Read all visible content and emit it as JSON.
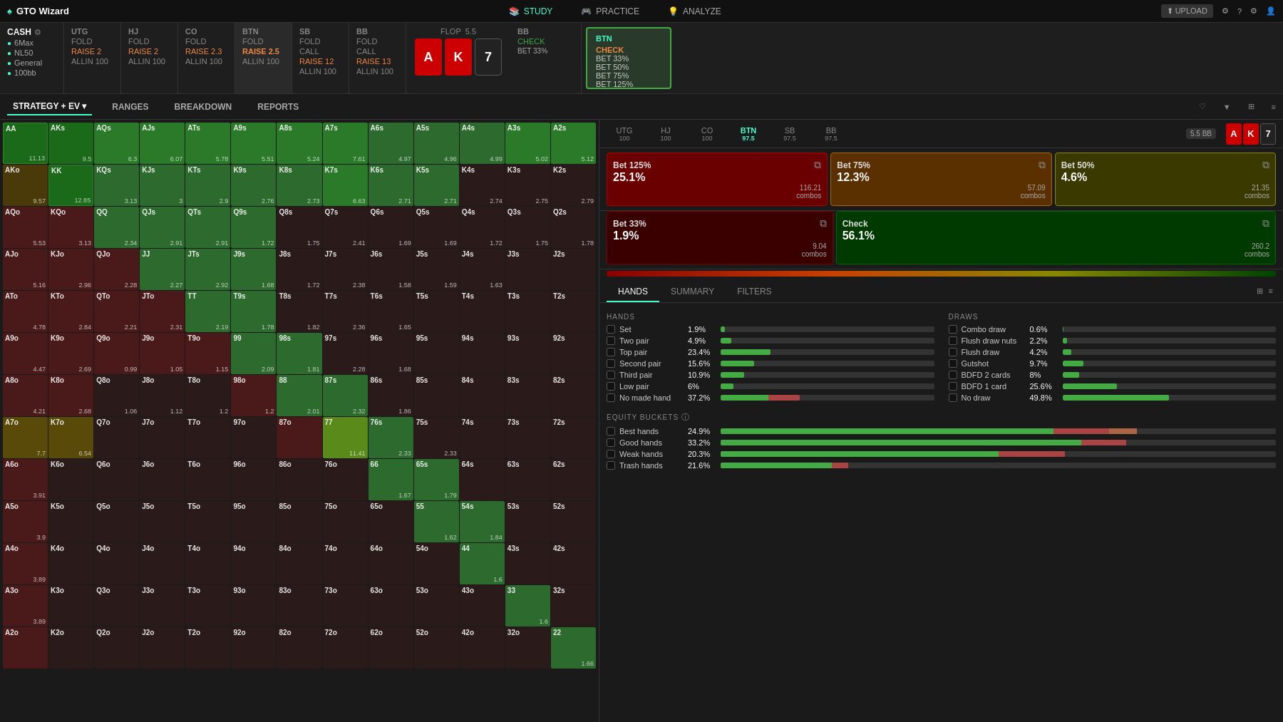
{
  "brand": {
    "name": "GTO Wizard",
    "icon": "♠"
  },
  "nav": {
    "items": [
      {
        "label": "STUDY",
        "icon": "📚",
        "active": true
      },
      {
        "label": "PRACTICE",
        "icon": "🎮",
        "active": false
      },
      {
        "label": "ANALYZE",
        "icon": "💡",
        "active": false
      }
    ],
    "right": [
      "upload_icon",
      "settings1",
      "settings2",
      "settings3",
      "avatar"
    ]
  },
  "positions": [
    {
      "label": "CASH",
      "sublabel": "",
      "actions": [
        "6Max",
        "NL50",
        "General",
        "100bb"
      ],
      "is_cash": true
    },
    {
      "label": "UTG",
      "sublabel": "",
      "actions": [
        "FOLD",
        "RAISE 2",
        "ALLIN 100"
      ]
    },
    {
      "label": "HJ",
      "sublabel": "",
      "actions": [
        "FOLD",
        "RAISE 2",
        "ALLIN 100"
      ]
    },
    {
      "label": "CO",
      "sublabel": "",
      "actions": [
        "FOLD",
        "RAISE 2.3",
        "ALLIN 100"
      ]
    },
    {
      "label": "BTN",
      "sublabel": "",
      "actions": [
        "FOLD",
        "RAISE 2.5",
        "ALLIN 100"
      ],
      "active": true
    },
    {
      "label": "SB",
      "sublabel": "",
      "actions": [
        "FOLD",
        "CALL",
        "RAISE 12",
        "ALLIN 100"
      ]
    },
    {
      "label": "BB",
      "sublabel": "",
      "actions": [
        "FOLD",
        "CALL",
        "RAISE 13",
        "ALLIN 100"
      ]
    }
  ],
  "flop": {
    "label": "FLOP",
    "value": "5.5",
    "cards": [
      "A",
      "K",
      "7"
    ]
  },
  "bb_action": {
    "label": "BB",
    "action": "CHECK",
    "details": "BET 33%"
  },
  "btn_actions": {
    "label": "BTN",
    "actions": [
      "CHECK",
      "BET 33%",
      "BET 50%",
      "BET 75%",
      "BET 125%"
    ]
  },
  "toolbar": {
    "items": [
      "STRATEGY + EV",
      "RANGES",
      "BREAKDOWN",
      "REPORTS"
    ]
  },
  "matrix": {
    "rows": [
      [
        "AA",
        "AKs",
        "AQs",
        "AJs",
        "ATs",
        "A9s",
        "A8s",
        "A7s",
        "A6s",
        "A5s",
        "A4s",
        "A3s",
        "A2s"
      ],
      [
        "AKo",
        "KK",
        "KQs",
        "KJs",
        "KTs",
        "K9s",
        "K8s",
        "K7s",
        "K6s",
        "K5s",
        "K4s",
        "K3s",
        "K2s"
      ],
      [
        "AQo",
        "KQo",
        "QQ",
        "QJs",
        "QTs",
        "Q9s",
        "Q8s",
        "Q7s",
        "Q6s",
        "Q5s",
        "Q4s",
        "Q3s",
        "Q2s"
      ],
      [
        "AJo",
        "KJo",
        "QJo",
        "JJ",
        "JTs",
        "J9s",
        "J8s",
        "J7s",
        "J6s",
        "J5s",
        "J4s",
        "J3s",
        "J2s"
      ],
      [
        "ATo",
        "KTo",
        "QTo",
        "JTo",
        "TT",
        "T9s",
        "T8s",
        "T7s",
        "T6s",
        "T5s",
        "T4s",
        "T3s",
        "T2s"
      ],
      [
        "A9o",
        "K9o",
        "Q9o",
        "J9o",
        "T9o",
        "99",
        "98s",
        "97s",
        "96s",
        "95s",
        "94s",
        "93s",
        "92s"
      ],
      [
        "A8o",
        "K8o",
        "Q8o",
        "J8o",
        "T8o",
        "98o",
        "88",
        "87s",
        "86s",
        "85s",
        "84s",
        "83s",
        "82s"
      ],
      [
        "A7o",
        "K7o",
        "Q7o",
        "J7o",
        "T7o",
        "97o",
        "87o",
        "77",
        "76s",
        "75s",
        "74s",
        "73s",
        "72s"
      ],
      [
        "A6o",
        "K6o",
        "Q6o",
        "J6o",
        "T6o",
        "96o",
        "86o",
        "76o",
        "66",
        "65s",
        "64s",
        "63s",
        "62s"
      ],
      [
        "A5o",
        "K5o",
        "Q5o",
        "J5o",
        "T5o",
        "95o",
        "85o",
        "75o",
        "65o",
        "55",
        "54s",
        "53s",
        "52s"
      ],
      [
        "A4o",
        "K4o",
        "Q4o",
        "J4o",
        "T4o",
        "94o",
        "84o",
        "74o",
        "64o",
        "54o",
        "44",
        "43s",
        "42s"
      ],
      [
        "A3o",
        "K3o",
        "Q3o",
        "J3o",
        "T3o",
        "93o",
        "83o",
        "73o",
        "63o",
        "53o",
        "43o",
        "33",
        "32s"
      ],
      [
        "A2o",
        "K2o",
        "Q2o",
        "J2o",
        "T2o",
        "92o",
        "82o",
        "72o",
        "62o",
        "52o",
        "42o",
        "32o",
        "22"
      ]
    ],
    "values": {
      "AA": "11.13",
      "AKs": "9.5",
      "AQs": "6.3",
      "AJs": "6.07",
      "ATs": "5.78",
      "A9s": "5.51",
      "A8s": "5.24",
      "A7s": "7.61",
      "A6s": "4.97",
      "A5s": "4.96",
      "A4s": "4.99",
      "A3s": "5.02",
      "A2s": "5.12",
      "AKo": "9.57",
      "KK": "12.85",
      "KQs": "3.13",
      "KJs": "3",
      "KTs": "2.9",
      "K9s": "2.76",
      "K8s": "2.73",
      "K7s": "6.63",
      "K6s": "2.71",
      "K5s": "2.71",
      "K4s": "2.74",
      "K3s": "2.75",
      "K2s": "2.79",
      "AQo": "5.53",
      "KQo": "3.13",
      "QQ": "2.34",
      "QJs": "2.91",
      "QTs": "2.91",
      "Q9s": "1.72",
      "Q8s": "1.75",
      "Q7s": "2.41",
      "Q6s": "1.69",
      "Q5s": "1.69",
      "Q4s": "1.72",
      "Q3s": "1.75",
      "Q2s": "1.78",
      "AJo": "5.16",
      "KJo": "2.96",
      "QJo": "2.28",
      "JJ": "2.27",
      "JTs": "2.92",
      "J9s": "1.68",
      "J8s": "1.72",
      "J7s": "2.38",
      "J6s": "1.58",
      "J5s": "1.59",
      "J4s": "1.63",
      "ATo": "4.78",
      "KTo": "2.84",
      "QTo": "2.21",
      "JTo": "2.31",
      "TT": "2.19",
      "T9s": "1.78",
      "T8s": "1.82",
      "T7s": "2.36",
      "T6s": "1.65",
      "A9o": "4.47",
      "K9o": "2.69",
      "Q9o": "0.99",
      "J9o": "1.05",
      "T9o": "1.15",
      "99": "2.09",
      "98s": "1.81",
      "97s": "2.28",
      "96s": "1.68",
      "A8o": "4.21",
      "K8o": "2.68",
      "Q8o": "1.06",
      "J8o": "1.12",
      "T8o": "1.2",
      "98o": "1.2",
      "88": "2.01",
      "87s": "2.32",
      "86s": "1.86",
      "A7o": "7.7",
      "K7o": "6.54",
      "77": "11.41",
      "76s": "2.33",
      "75s": "2.33",
      "A6o": "3.91",
      "66": "1.67",
      "65s": "1.79",
      "A5o": "3.9",
      "55": "1.62",
      "54s": "1.84",
      "A4o": "3.89",
      "44": "1.6",
      "A3o": "3.89",
      "33": "1.6",
      "22": "1.66"
    }
  },
  "right_panel": {
    "pos_headers": [
      {
        "label": "UTG",
        "sublabel": "100",
        "active": false
      },
      {
        "label": "HJ",
        "sublabel": "100",
        "active": false
      },
      {
        "label": "CO",
        "sublabel": "100",
        "active": false
      },
      {
        "label": "BTN",
        "sublabel": "97.5",
        "active": true
      },
      {
        "label": "SB",
        "sublabel": "97.5",
        "active": false
      },
      {
        "label": "BB",
        "sublabel": "97.5",
        "active": false
      }
    ],
    "flop_badge": "5.5 BB",
    "cards": [
      "A",
      "K",
      "7"
    ],
    "action_boxes": [
      {
        "label": "Bet 125%",
        "pct": "25.1%",
        "combos": "116.21",
        "color": "red"
      },
      {
        "label": "Bet 75%",
        "pct": "12.3%",
        "combos": "57.09",
        "color": "orange"
      },
      {
        "label": "Bet 50%",
        "pct": "4.6%",
        "combos": "21.35",
        "color": "yellow"
      },
      {
        "label": "Bet 33%",
        "pct": "1.9%",
        "combos": "9.04",
        "color": "darkred"
      },
      {
        "label": "Check",
        "pct": "56.1%",
        "combos": "260.2",
        "color": "green"
      }
    ],
    "tabs": [
      "HANDS",
      "SUMMARY",
      "FILTERS"
    ],
    "active_tab": "HANDS",
    "hands_section": {
      "title": "HANDS",
      "rows": [
        {
          "label": "Set",
          "pct": "1.9%",
          "bar_green": 1.9,
          "bar_red": 0
        },
        {
          "label": "Two pair",
          "pct": "4.9%",
          "bar_green": 4.9,
          "bar_red": 0
        },
        {
          "label": "Top pair",
          "pct": "23.4%",
          "bar_green": 23.4,
          "bar_red": 0
        },
        {
          "label": "Second pair",
          "pct": "15.6%",
          "bar_green": 15.6,
          "bar_red": 0
        },
        {
          "label": "Third pair",
          "pct": "10.9%",
          "bar_green": 10.9,
          "bar_red": 0
        },
        {
          "label": "Low pair",
          "pct": "6%",
          "bar_green": 6,
          "bar_red": 0
        },
        {
          "label": "No made hand",
          "pct": "37.2%",
          "bar_green": 37.2,
          "bar_red": 0
        }
      ]
    },
    "draws_section": {
      "title": "DRAWS",
      "rows": [
        {
          "label": "Combo draw",
          "pct": "0.6%",
          "bar_green": 0.6,
          "bar_red": 0
        },
        {
          "label": "Flush draw nuts",
          "pct": "2.2%",
          "bar_green": 2.2,
          "bar_red": 0
        },
        {
          "label": "Flush draw",
          "pct": "4.2%",
          "bar_green": 4.2,
          "bar_red": 0
        },
        {
          "label": "Gutshot",
          "pct": "9.7%",
          "bar_green": 9.7,
          "bar_red": 0
        },
        {
          "label": "BDFD 2 cards",
          "pct": "8%",
          "bar_green": 8,
          "bar_red": 0
        },
        {
          "label": "BDFD 1 card",
          "pct": "25.6%",
          "bar_green": 25.6,
          "bar_red": 0
        },
        {
          "label": "No draw",
          "pct": "49.8%",
          "bar_green": 49.8,
          "bar_red": 0
        }
      ]
    },
    "equity_section": {
      "title": "EQUITY BUCKETS",
      "rows": [
        {
          "label": "Best hands",
          "pct": "24.9%",
          "bar_green": 60,
          "bar_red": 20
        },
        {
          "label": "Good hands",
          "pct": "33.2%",
          "bar_green": 65,
          "bar_red": 10
        },
        {
          "label": "Weak hands",
          "pct": "20.3%",
          "bar_green": 50,
          "bar_red": 15
        },
        {
          "label": "Trash hands",
          "pct": "21.6%",
          "bar_green": 20,
          "bar_red": 5
        }
      ]
    }
  }
}
